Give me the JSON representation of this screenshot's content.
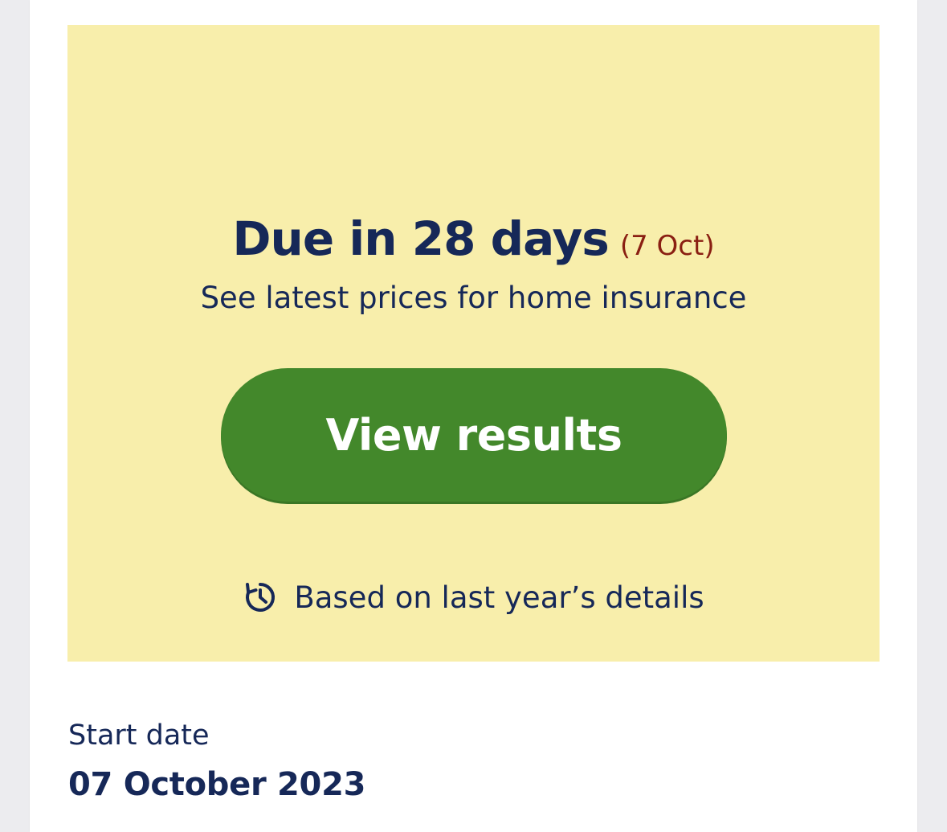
{
  "renewal": {
    "heading": "Due in 28 days",
    "due_date": "(7 Oct)",
    "subtitle": "See latest prices for home insurance",
    "button_label": "View results",
    "note_icon": "clock-history-icon",
    "note": "Based on last year’s details"
  },
  "policy": {
    "start_date_label": "Start date",
    "start_date_value": "07 October 2023"
  },
  "colors": {
    "panel_background": "#f8eeab",
    "navy_text": "#162858",
    "date_accent": "#8a1f12",
    "button_green": "#43882b"
  }
}
